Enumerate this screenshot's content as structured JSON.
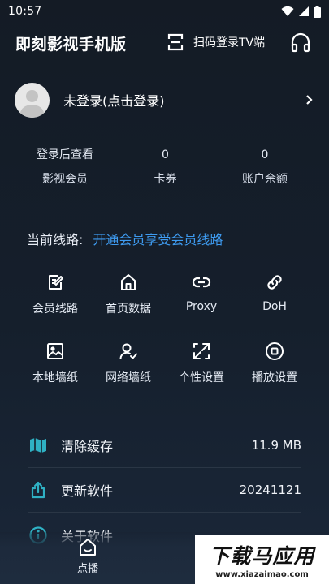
{
  "status_bar": {
    "time": "10:57"
  },
  "header": {
    "title": "即刻影视手机版",
    "scan_label": "扫码登录TV端"
  },
  "user": {
    "name": "未登录(点击登录)"
  },
  "stats": [
    {
      "value": "登录后查看",
      "label": "影视会员"
    },
    {
      "value": "0",
      "label": "卡券"
    },
    {
      "value": "0",
      "label": "账户余额"
    }
  ],
  "line": {
    "label": "当前线路:",
    "link": "开通会员享受会员线路"
  },
  "grid": [
    {
      "label": "会员线路",
      "icon": "edit-doc-icon"
    },
    {
      "label": "首页数据",
      "icon": "home-icon"
    },
    {
      "label": "Proxy",
      "icon": "link-icon"
    },
    {
      "label": "DoH",
      "icon": "chain-link-icon"
    },
    {
      "label": "本地墙纸",
      "icon": "image-icon"
    },
    {
      "label": "网络墙纸",
      "icon": "user-check-icon"
    },
    {
      "label": "个性设置",
      "icon": "expand-icon"
    },
    {
      "label": "播放设置",
      "icon": "stop-circle-icon"
    }
  ],
  "settings": [
    {
      "label": "清除缓存",
      "value": "11.9 MB",
      "icon": "map-icon"
    },
    {
      "label": "更新软件",
      "value": "20241121",
      "icon": "share-icon"
    },
    {
      "label": "关于软件",
      "value": "",
      "icon": "info-icon"
    }
  ],
  "bottom_nav": {
    "label": "点播"
  },
  "watermark": {
    "main": "下载马应用",
    "sub": "www.xiazaimao.com"
  },
  "colors": {
    "accent_link": "#3e9bf0",
    "background": "#151f2c",
    "setting_icon": "#2fb1c4"
  }
}
